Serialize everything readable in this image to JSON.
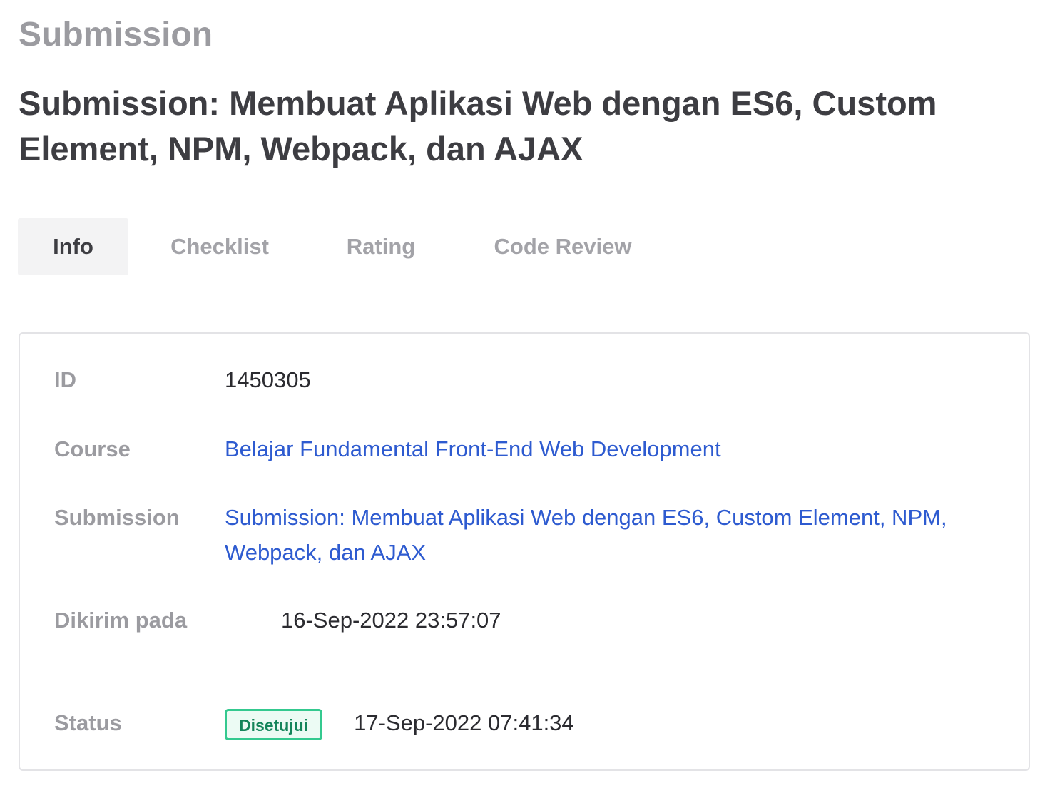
{
  "header": {
    "page_heading": "Submission",
    "submission_title": "Submission: Membuat Aplikasi Web dengan ES6, Custom Element, NPM, Webpack, dan AJAX"
  },
  "tabs": [
    {
      "label": "Info",
      "active": true
    },
    {
      "label": "Checklist",
      "active": false
    },
    {
      "label": "Rating",
      "active": false
    },
    {
      "label": "Code Review",
      "active": false
    }
  ],
  "info": {
    "id_label": "ID",
    "id_value": "1450305",
    "course_label": "Course",
    "course_value": "Belajar Fundamental Front-End Web Development",
    "submission_label": "Submission",
    "submission_value": "Submission: Membuat Aplikasi Web dengan ES6, Custom Element, NPM, Webpack, dan AJAX",
    "sent_label": "Dikirim pada",
    "sent_value": "16-Sep-2022 23:57:07",
    "status_label": "Status",
    "status_badge": "Disetujui",
    "status_date": "17-Sep-2022 07:41:34"
  },
  "colors": {
    "link": "#2e5bd0",
    "badge_border": "#34c98f",
    "badge_text": "#14855a",
    "muted": "#9b9ba0"
  }
}
